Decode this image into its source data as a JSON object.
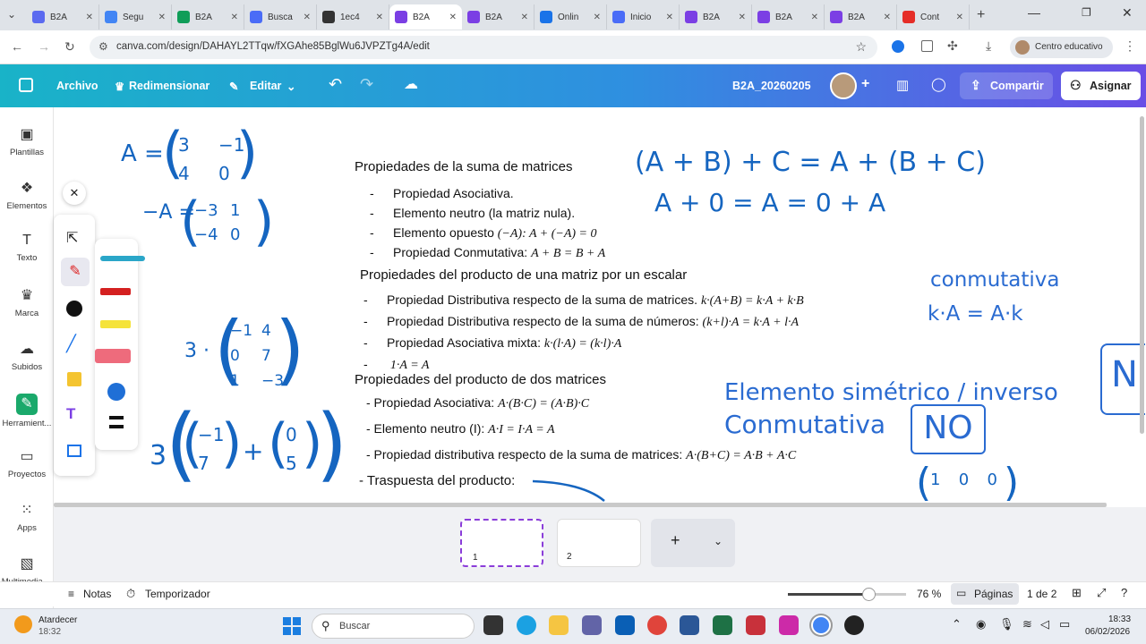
{
  "browser": {
    "tabs": [
      {
        "label": "B2A",
        "color": "#5b6af0"
      },
      {
        "label": "Segu",
        "color": "#4285f4"
      },
      {
        "label": "B2A",
        "color": "#0f9d58"
      },
      {
        "label": "Busca",
        "color": "#4a6cf7"
      },
      {
        "label": "1ec4",
        "color": "#333333"
      },
      {
        "label": "B2A",
        "color": "#7b3fe4",
        "active": true
      },
      {
        "label": "B2A",
        "color": "#7b3fe4"
      },
      {
        "label": "Onlin",
        "color": "#1a73e8"
      },
      {
        "label": "Inicio",
        "color": "#4a6cf7"
      },
      {
        "label": "B2A",
        "color": "#7b3fe4"
      },
      {
        "label": "B2A",
        "color": "#7b3fe4"
      },
      {
        "label": "B2A",
        "color": "#7b3fe4"
      },
      {
        "label": "Cont",
        "color": "#e52d27"
      }
    ],
    "url": "canva.com/design/DAHAYL2TTqw/fXGAhe85BglWu6JVPZTg4A/edit",
    "profile": "Centro educativo"
  },
  "canva": {
    "menu_file": "Archivo",
    "menu_resize": "Redimensionar",
    "menu_edit": "Editar",
    "doc_name": "B2A_20260205",
    "share": "Compartir",
    "assign": "Asignar",
    "accent": "#2f8fe0"
  },
  "sidebar": [
    {
      "label": "Plantillas",
      "icon": "templates-icon"
    },
    {
      "label": "Elementos",
      "icon": "elements-icon"
    },
    {
      "label": "Texto",
      "icon": "text-icon"
    },
    {
      "label": "Marca",
      "icon": "brand-icon"
    },
    {
      "label": "Subidos",
      "icon": "uploads-icon"
    },
    {
      "label": "Herramient...",
      "icon": "tools-icon"
    },
    {
      "label": "Proyectos",
      "icon": "projects-icon"
    },
    {
      "label": "Apps",
      "icon": "apps-icon"
    },
    {
      "label": "Multimedia ...",
      "icon": "media-icon"
    }
  ],
  "slide": {
    "sum_title": "Propiedades de la suma de matrices",
    "sum_items": [
      {
        "label": "Propiedad Asociativa."
      },
      {
        "label": "Elemento neutro (la matriz nula)."
      },
      {
        "label": "Elemento opuesto",
        "formula": "(−A): A + (−A) = 0"
      },
      {
        "label": "Propiedad Conmutativa:",
        "formula": "A + B = B + A"
      }
    ],
    "scalar_title": "Propiedades del producto de una matriz por un escalar",
    "scalar_items": [
      {
        "label": "Propiedad Distributiva respecto de la suma de matrices.",
        "formula": "k·(A+B) = k·A + k·B"
      },
      {
        "label": "Propiedad Distributiva respecto de la suma de números:",
        "formula": "(k+l)·A = k·A + l·A"
      },
      {
        "label": "Propiedad Asociativa mixta:",
        "formula": "k·(l·A) = (k·l)·A"
      },
      {
        "label": "",
        "formula": "1·A = A"
      }
    ],
    "prod_title": "Propiedades del producto de dos matrices",
    "prod_items": [
      {
        "label": "- Propiedad Asociativa:",
        "formula": "A·(B·C) = (A·B)·C"
      },
      {
        "label": "- Elemento neutro (I):",
        "formula": "A·I = I·A = A"
      },
      {
        "label": "- Propiedad distributiva respecto de la suma de matrices:",
        "formula": "A·(B+C) = A·B + A·C"
      }
    ],
    "transpose": "- Traspuesta del producto:",
    "handwriting": {
      "assoc": "(A + B) + C = A + (B + C)",
      "neutral": "A + 0 = A = 0 + A",
      "conm_label": "conmutativa",
      "conm_formula": "k·A = A·k",
      "symmetric": "Elemento simétrico / inverso",
      "prod_conm": "Conmutativa",
      "no": "NO",
      "no_partial": "N",
      "matrix_a_label": "A =",
      "matrix_a": [
        "3",
        "−1",
        "4",
        "0"
      ],
      "matrix_neg_label": "−A =",
      "matrix_neg": [
        "−3",
        "1",
        "−4",
        "0"
      ],
      "scalar_k": "3 ·",
      "matrix_s": [
        "−1",
        "4",
        "0",
        "7",
        "1",
        "−3"
      ],
      "scalar_k2": "3",
      "vec1": [
        "−1",
        "7"
      ],
      "plus": "+",
      "vec2": [
        "0",
        "5"
      ],
      "identity_partial": [
        "1",
        "0",
        "0"
      ]
    }
  },
  "pages": {
    "thumb1": "1",
    "thumb2": "2",
    "add": "+"
  },
  "status": {
    "notes": "Notas",
    "timer": "Temporizador",
    "zoom": "76 %",
    "pages_label": "Páginas",
    "page_count": "1 de 2",
    "zoom_level": 0.76
  },
  "taskbar": {
    "weather": "Atardecer",
    "weather_time": "18:32",
    "search": "Buscar",
    "time": "18:33",
    "date": "06/02/2026"
  }
}
